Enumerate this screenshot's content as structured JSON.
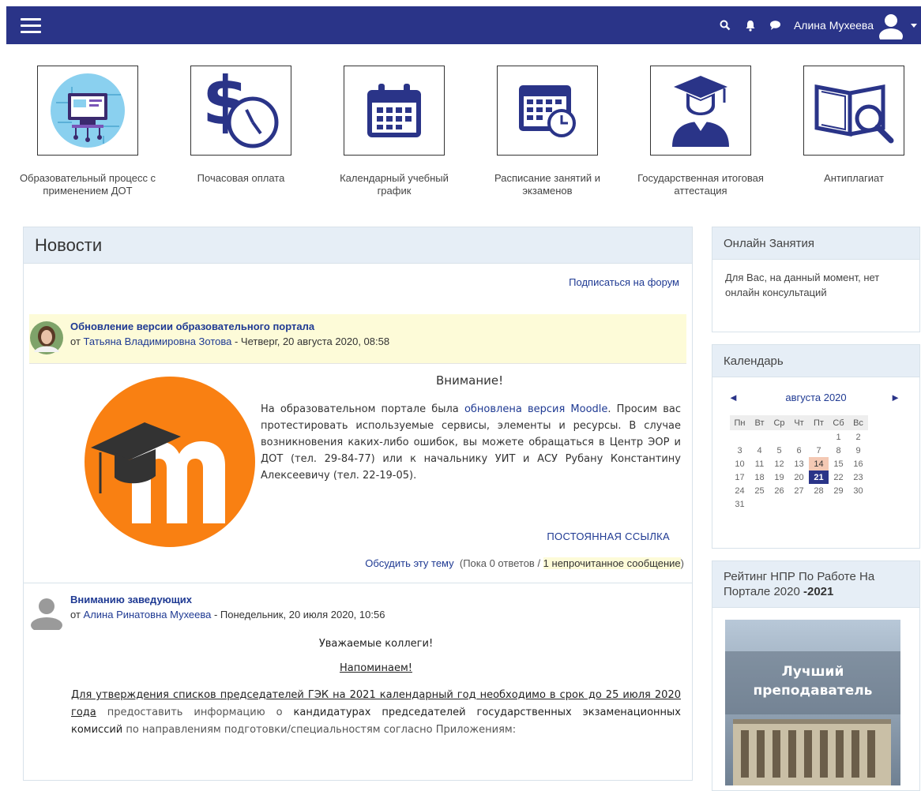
{
  "navbar": {
    "user_name": "Алина Мухеева",
    "icons": [
      "menu-icon",
      "search-icon",
      "bell-icon",
      "chat-icon",
      "user-icon",
      "caret-down-icon"
    ],
    "bg_color": "#2a3488"
  },
  "tiles": [
    {
      "label": "Образовательный процесс с применением ДОТ",
      "icon": "computer-network-icon"
    },
    {
      "label": "Почасовая оплата",
      "icon": "dollar-clock-icon"
    },
    {
      "label": "Календарный учебный график",
      "icon": "calendar-icon"
    },
    {
      "label": "Расписание занятий и экзаменов",
      "icon": "schedule-icon"
    },
    {
      "label": "Государственная итоговая аттестация",
      "icon": "graduate-icon"
    },
    {
      "label": "Антиплагиат",
      "icon": "book-search-icon"
    }
  ],
  "news": {
    "title": "Новости",
    "subscribe": "Подписаться на форум",
    "post1": {
      "title": "Обновление версии образовательного портала",
      "from": "от",
      "author": "Татьяна Владимировна Зотова",
      "date": " - Четверг, 20 августа 2020, 08:58",
      "heading": "Внимание!",
      "body_a": "На образовательном портале была ",
      "body_link": "обновлена версия Moodle",
      "body_b": ". Просим вас протестировать используемые сервисы, элементы и ресурсы. В случае возникновения каких-либо ошибок, вы можете обращаться в Центр ЭОР и ДОТ (тел. 29-84-77) или к начальнику УИТ и АСУ Рубану Константину Алексеевичу (тел. 22-19-05).",
      "permalink": "ПОСТОЯННАЯ ССЫЛКА",
      "discuss": "Обсудить эту тему",
      "replies": "(Пока 0 ответов / ",
      "unread": "1 непрочитанное сообщение",
      "close_paren": ")"
    },
    "post2": {
      "title": "Вниманию заведующих",
      "from": "от",
      "author": "Алина Ринатовна Мухеева",
      "date": " - Понедельник, 20 июля 2020, 10:56",
      "greeting": "Уважаемые коллеги!",
      "remind": "Напоминаем!",
      "text_a": "Для утверждения списков председателей ГЭК на 2021 календарный год необходимо в срок до 25 июля 2020 года",
      "text_b": " предоставить информацию о ",
      "text_c": "кандидатурах председателей государственных экзаменационных комиссий",
      "text_d": " по направлениям подготовки/специальностям согласно Приложениям:"
    }
  },
  "online": {
    "title": "Онлайн Занятия",
    "text": "Для Вас, на данный момент, нет онлайн консультаций"
  },
  "calendar": {
    "title": "Календарь",
    "month": "августа 2020",
    "prev": "◄",
    "next": "►",
    "weekdays": [
      "Пн",
      "Вт",
      "Ср",
      "Чт",
      "Пт",
      "Сб",
      "Вс"
    ],
    "weeks": [
      [
        "",
        "",
        "",
        "",
        "",
        "1",
        "2"
      ],
      [
        "3",
        "4",
        "5",
        "6",
        "7",
        "8",
        "9"
      ],
      [
        "10",
        "11",
        "12",
        "13",
        "14",
        "15",
        "16"
      ],
      [
        "17",
        "18",
        "19",
        "20",
        "21",
        "22",
        "23"
      ],
      [
        "24",
        "25",
        "26",
        "27",
        "28",
        "29",
        "30"
      ],
      [
        "31",
        "",
        "",
        "",
        "",
        "",
        ""
      ]
    ],
    "today": "21",
    "event_day": "14"
  },
  "rating": {
    "title_a": "Рейтинг НПР По Работе На Портале 2020",
    "title_b": "-2021",
    "image_text_1": "Лучший",
    "image_text_2": "преподаватель"
  }
}
